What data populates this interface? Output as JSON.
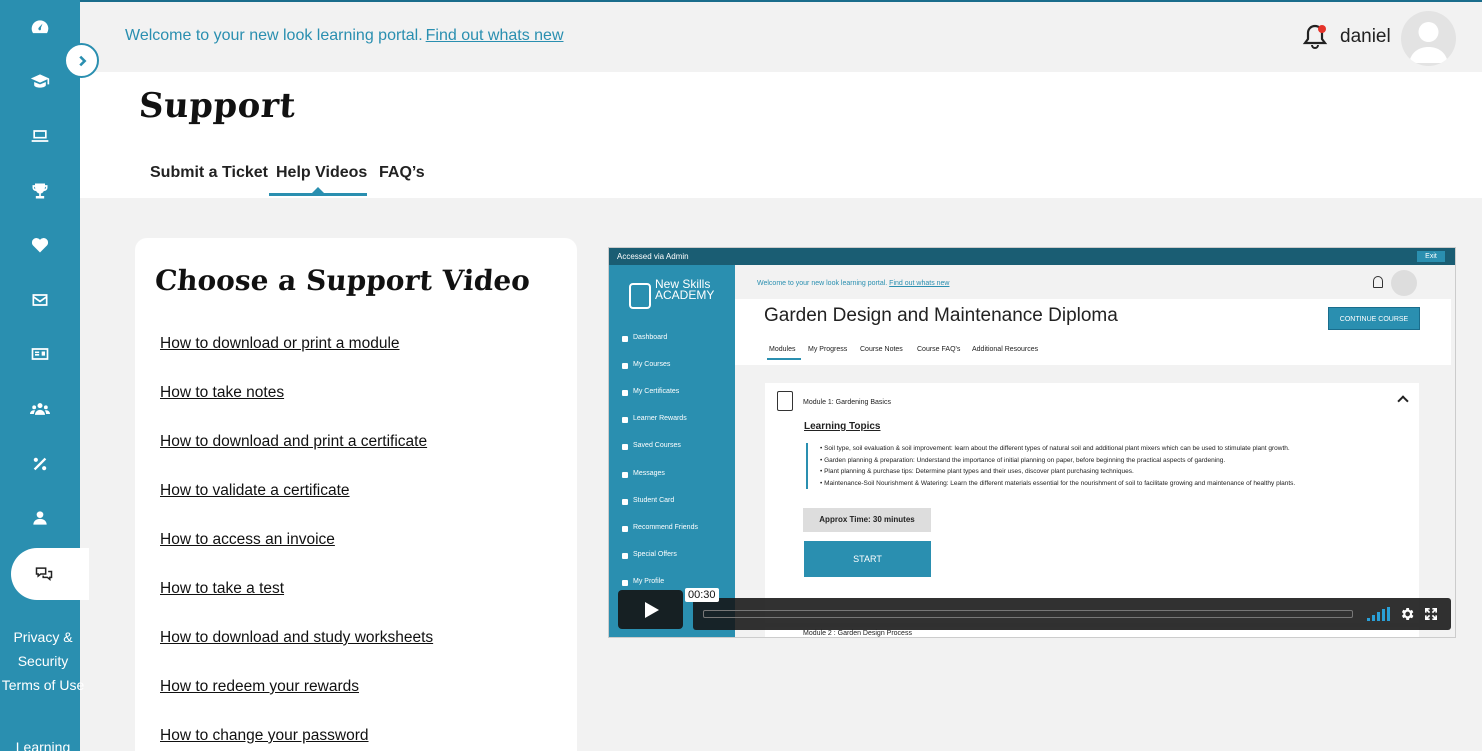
{
  "header": {
    "welcome_text": "Welcome to your new look learning portal.",
    "welcome_link": "Find out whats new",
    "username": "daniel"
  },
  "sidebar": {
    "icons": [
      "dashboard-icon",
      "graduation-cap-icon",
      "laptop-icon",
      "trophy-icon",
      "heart-icon",
      "envelope-icon",
      "id-card-icon",
      "users-icon",
      "percent-icon",
      "user-icon",
      "chat-icon"
    ],
    "footer_links": [
      "Privacy & Security",
      "Terms of Use",
      "Learning"
    ]
  },
  "page": {
    "title": "Support",
    "tabs": [
      {
        "label": "Submit a Ticket",
        "active": false
      },
      {
        "label": "Help Videos",
        "active": true
      },
      {
        "label": "FAQ’s",
        "active": false
      }
    ]
  },
  "videos_card": {
    "title": "Choose a Support Video",
    "links": [
      "How to download or print a module",
      "How to take notes",
      "How to download and print a certificate",
      "How to validate a certificate",
      "How to access an invoice",
      "How to take a test",
      "How to download and study worksheets",
      "How to redeem your rewards",
      "How to change your password"
    ]
  },
  "video": {
    "topbar_text": "Accessed via Admin",
    "exit_label": "Exit",
    "logo_text": [
      "New Skills",
      "ACADEMY"
    ],
    "nav_items": [
      "Dashboard",
      "My Courses",
      "My Certificates",
      "Learner Rewards",
      "Saved Courses",
      "Messages",
      "Student Card",
      "Recommend Friends",
      "Special Offers",
      "My Profile"
    ],
    "welcome_text": "Welcome to your new look learning portal.",
    "welcome_link": "Find out whats new",
    "course_title": "Garden Design and Maintenance Diploma",
    "continue_label": "CONTINUE COURSE",
    "course_tabs": [
      "Modules",
      "My Progress",
      "Course Notes",
      "Course FAQ's",
      "Additional Resources"
    ],
    "module1_title": "Module 1: Gardening Basics",
    "topics_heading": "Learning Topics",
    "topics": [
      "Soil type, soil evaluation & soil improvement: learn about the different types of natural soil and additional plant mixers which can be used to stimulate plant growth.",
      "Garden planning & preparation: Understand the importance of initial planning on paper, before beginning the practical aspects of gardening.",
      "Plant planning & purchase tips: Determine plant types and their uses, discover plant purchasing techniques.",
      "Maintenance-Soil Nourishment & Watering: Learn the different materials essential for the nourishment of soil to facilitate growing and maintenance of healthy plants."
    ],
    "approx_time": "Approx Time: 30 minutes",
    "start_label": "START",
    "module2_title": "Module 2 : Garden Design Process",
    "timestamp": "00:30"
  }
}
